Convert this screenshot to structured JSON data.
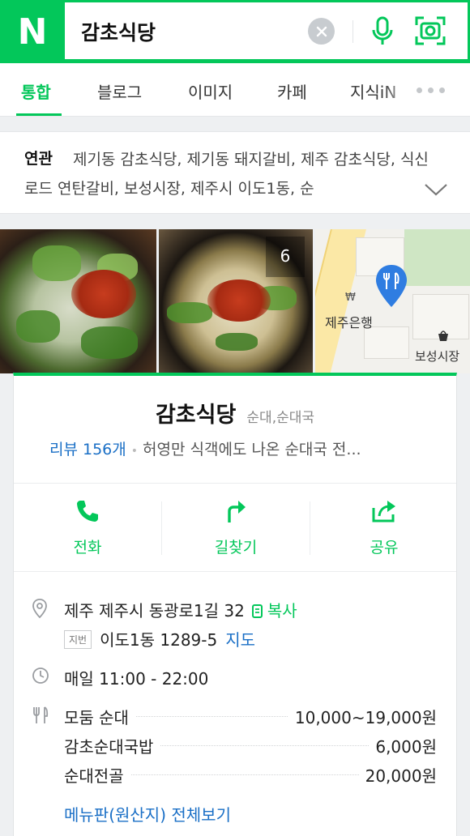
{
  "search": {
    "logo": "N",
    "query": "감초식당",
    "clear_icon": "close-icon",
    "mic_icon": "microphone-icon",
    "lens_icon": "lens-icon"
  },
  "tabs": [
    {
      "label": "통합",
      "active": true
    },
    {
      "label": "블로그",
      "active": false
    },
    {
      "label": "이미지",
      "active": false
    },
    {
      "label": "카페",
      "active": false
    },
    {
      "label": "지식iN",
      "active": false
    }
  ],
  "related": {
    "label": "연관",
    "keywords": "제기동 감초식당, 제기동 돼지갈비, 제주 감초식당, 식신로드 연탄갈비, 보성시장, 제주시 이도1동, 순"
  },
  "photos": {
    "count": "6"
  },
  "map": {
    "bank_label": "제주은행",
    "market_label": "보성시장"
  },
  "place": {
    "name": "감초식당",
    "category": "순대,순대국",
    "review_link": "리뷰 156개",
    "blurb": "허영만 식객에도 나온 순대국 전..."
  },
  "actions": [
    {
      "label": "전화",
      "icon": "phone-icon"
    },
    {
      "label": "길찾기",
      "icon": "directions-icon"
    },
    {
      "label": "공유",
      "icon": "share-icon"
    }
  ],
  "info": {
    "address": "제주 제주시 동광로1길 32",
    "copy_label": "복사",
    "lot_badge": "지번",
    "lot_address": "이도1동 1289-5",
    "map_link": "지도",
    "hours": "매일 11:00 - 22:00",
    "menu": [
      {
        "name": "모둠 순대",
        "price": "10,000~19,000원"
      },
      {
        "name": "감초순대국밥",
        "price": "6,000원"
      },
      {
        "name": "순대전골",
        "price": "20,000원"
      }
    ],
    "menu_all": "메뉴판(원산지) 전체보기"
  },
  "colors": {
    "brand": "#03c75a",
    "link": "#1a6fc6"
  }
}
